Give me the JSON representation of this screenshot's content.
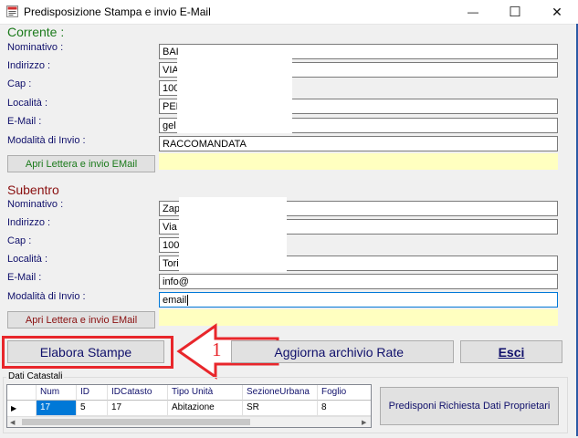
{
  "window": {
    "title": "Predisposizione Stampa e invio E-Mail",
    "minimize_glyph": "—",
    "maximize_glyph": "☐",
    "close_glyph": "✕"
  },
  "corrente": {
    "title": "Corrente :",
    "fields": [
      {
        "label": "Nominativo :",
        "value": "BAI"
      },
      {
        "label": "Indirizzo :",
        "value": "VIA"
      },
      {
        "label": "Cap :",
        "value": "100"
      },
      {
        "label": "Località :",
        "value": "PEF"
      },
      {
        "label": "E-Mail :",
        "value": "gel"
      },
      {
        "label": "Modalità di Invio :",
        "value": "RACCOMANDATA"
      }
    ],
    "button": "Apri Lettera e invio EMail"
  },
  "subentro": {
    "title": "Subentro",
    "fields": [
      {
        "label": "Nominativo :",
        "value": "Zap"
      },
      {
        "label": "Indirizzo :",
        "value": "Via"
      },
      {
        "label": "Cap :",
        "value": "100"
      },
      {
        "label": "Località :",
        "value": "Tori"
      },
      {
        "label": "E-Mail :",
        "value": "info@"
      },
      {
        "label": "Modalità di Invio :",
        "value": "email"
      }
    ],
    "button": "Apri Lettera e invio EMail"
  },
  "actions": {
    "elabora": "Elabora Stampe",
    "aggiorna": "Aggiorna  archivio Rate",
    "esci": "Esci",
    "callout_number": "1"
  },
  "catastali": {
    "title": "Dati Catastali",
    "columns": [
      "Num",
      "ID",
      "IDCatasto",
      "Tipo Unità",
      "SezioneUrbana",
      "Foglio"
    ],
    "rows": [
      [
        "17",
        "5",
        "17",
        "Abitazione",
        "SR",
        "8"
      ]
    ],
    "button": "Predisponi Richiesta Dati Proprietari"
  },
  "colors": {
    "accent": "#0078d7",
    "callout": "#e8262b",
    "corrente_title": "#1b7a1b",
    "subentro_title": "#8a1010"
  }
}
